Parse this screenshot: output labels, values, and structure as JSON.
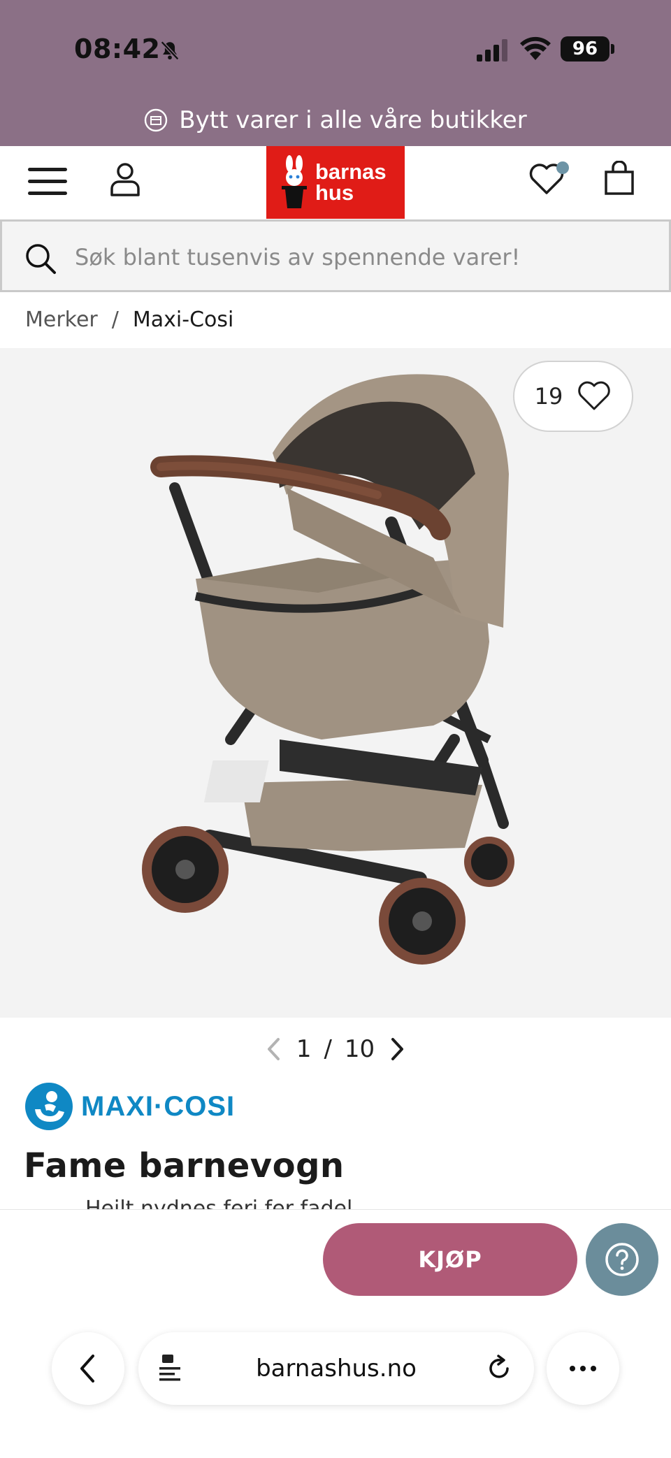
{
  "status_bar": {
    "time": "08:42",
    "battery": "96"
  },
  "promo": {
    "text": "Bytt varer i alle våre butikker"
  },
  "header": {
    "logo_line1": "barnas",
    "logo_line2": "hus",
    "wishlist_has_items": true
  },
  "search": {
    "placeholder": "Søk blant tusenvis av spennende varer!"
  },
  "breadcrumb": {
    "items": [
      "Merker",
      "Maxi-Cosi"
    ],
    "separator": "/"
  },
  "product": {
    "favorite_count": "19",
    "image_index": "1",
    "image_total": "10",
    "brand": "MAXI·COSI",
    "title": "Fame barnevogn",
    "subtitle_cut": "Heilt nydnes feri fer fadel"
  },
  "cta": {
    "buy_label": "KJØP"
  },
  "browser": {
    "url": "barnashus.no"
  },
  "colors": {
    "top_bar": "#8b7086",
    "logo_bg": "#e01c17",
    "buy_button": "#b05a77",
    "help_button": "#6b8d9b",
    "brand_blue": "#0f88c4"
  }
}
